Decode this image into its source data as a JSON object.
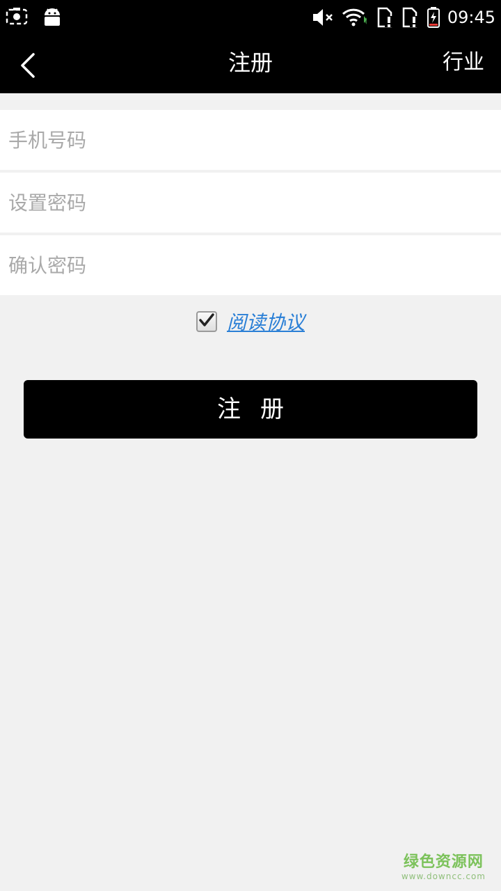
{
  "status_bar": {
    "time": "09:45",
    "icons": [
      "screenshot-icon",
      "android-icon",
      "mute-icon",
      "wifi-icon",
      "sim-alert-icon",
      "sim-alert-icon",
      "battery-charging-icon"
    ]
  },
  "app_bar": {
    "title": "注册",
    "right_action": "行业",
    "back_icon": "chevron-left-icon"
  },
  "form": {
    "phone_placeholder": "手机号码",
    "password_placeholder": "设置密码",
    "confirm_placeholder": "确认密码",
    "agreement_checked": true,
    "agreement_label": "阅读协议"
  },
  "register_button": "注册",
  "watermark": {
    "title": "绿色资源网",
    "url": "www.downcc.com"
  },
  "colors": {
    "bar": "#000000",
    "background": "#f1f1f1",
    "link": "#2a7fd6",
    "watermark": "#7cc25b"
  }
}
